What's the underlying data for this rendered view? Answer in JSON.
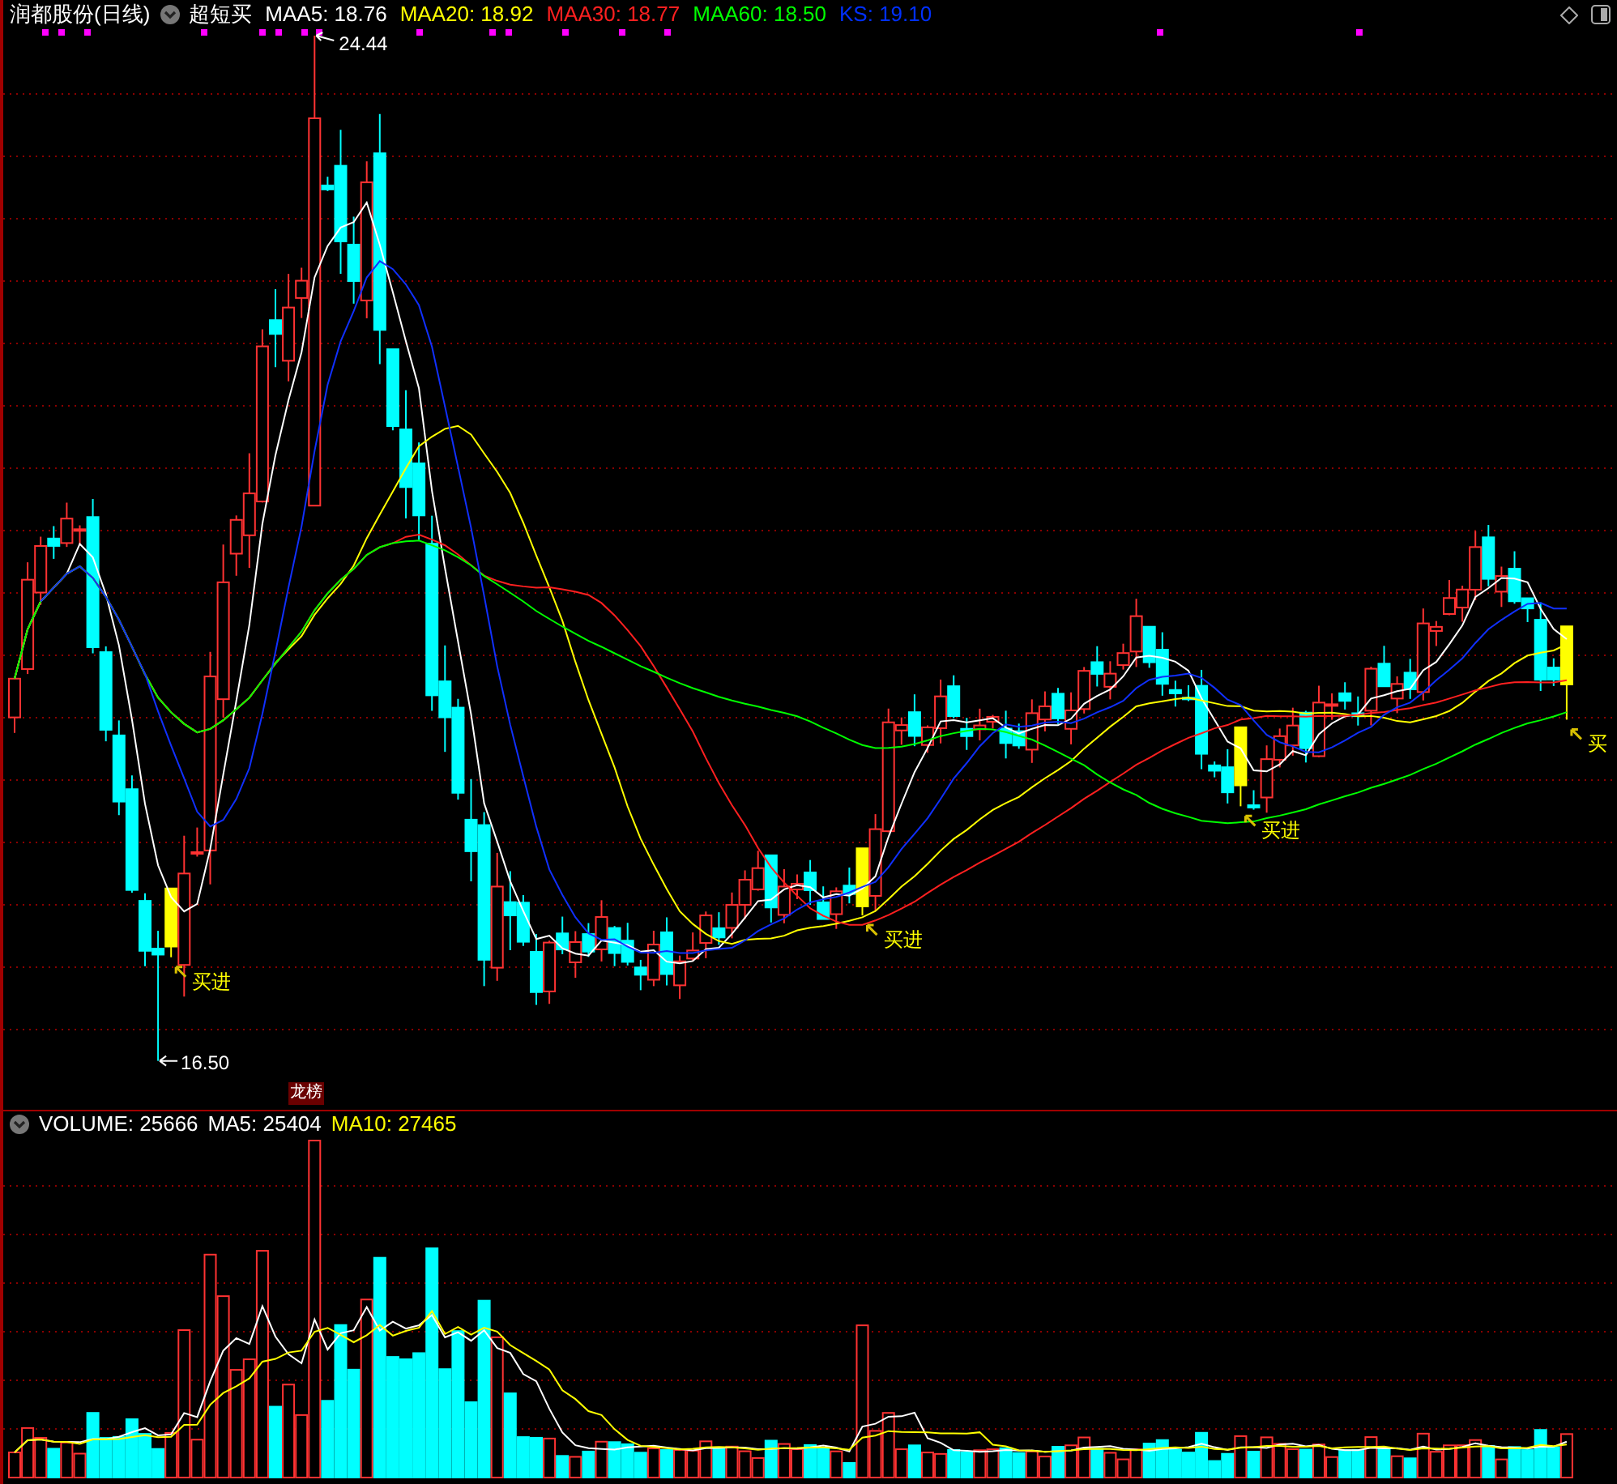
{
  "price_pane": {
    "title": "润都股份(日线)",
    "indicator": "超短买",
    "legend": [
      {
        "label": "MAA5: 18.76",
        "color": "#ffffff"
      },
      {
        "label": "MAA20: 18.92",
        "color": "#ffff00"
      },
      {
        "label": "MAA30: 18.77",
        "color": "#ff2020"
      },
      {
        "label": "MAA60: 18.50",
        "color": "#00ff00"
      },
      {
        "label": "KS: 19.10",
        "color": "#0030ff"
      }
    ],
    "high_label": "24.44",
    "low_label": "16.50",
    "badge": "龙榜",
    "signals": [
      {
        "text": "买进"
      },
      {
        "text": "买进"
      },
      {
        "text": "买进"
      },
      {
        "text": "买"
      }
    ]
  },
  "volume_pane": {
    "legend": [
      {
        "label": "VOLUME: 25666",
        "color": "#ffffff"
      },
      {
        "label": "MA5: 25404",
        "color": "#ffffff"
      },
      {
        "label": "MA10: 27465",
        "color": "#ffff00"
      }
    ]
  }
}
